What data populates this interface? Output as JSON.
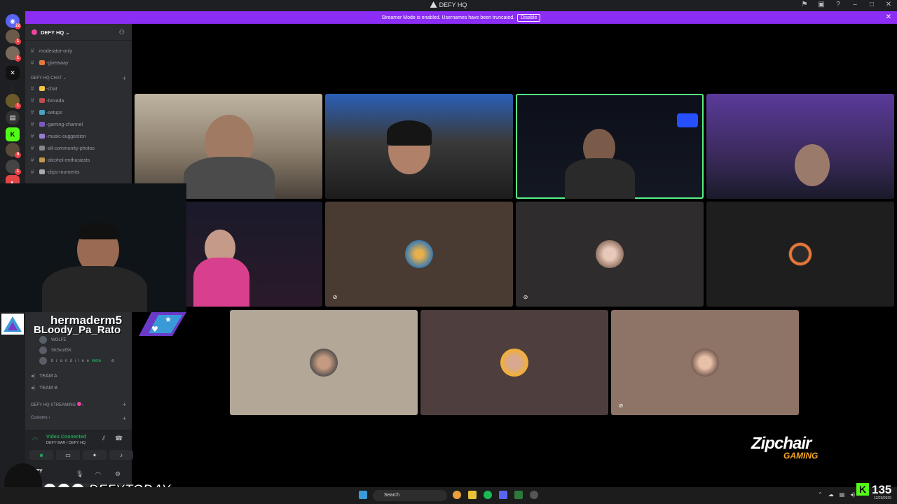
{
  "window": {
    "title": "DEFY HQ"
  },
  "banner": {
    "message": "Streamer Mode is enabled. Usernames have been truncated.",
    "disable_label": "Disable"
  },
  "rail": {
    "badges": [
      "22",
      "1",
      "1",
      "1",
      "9",
      "1"
    ]
  },
  "guild": {
    "name": "DEFY HQ"
  },
  "channels_top": [
    "moderator-only",
    "-giveaway"
  ],
  "category_chat": "DEFY HQ CHAT",
  "channels_chat": [
    "-chat",
    "-bovada",
    "-setups",
    "-gaming-channel",
    "-music-suggestion",
    "-all-community-photos",
    "-alcohol-enthusiasts",
    "-clips-moments"
  ],
  "voice_users": [
    {
      "name": "WOLFE",
      "tag": ""
    },
    {
      "name": "SKSkullSK",
      "tag": ""
    },
    {
      "name": "b r a n d i l e e",
      "tag": "HKIA"
    }
  ],
  "voice_channels": [
    "TEAM A",
    "TEAM B"
  ],
  "category_streaming": "DEFY HQ STREAMING",
  "category_customs": "Customs",
  "voice_panel": {
    "status": "Video Connected",
    "location": "DEFY BAR / DEFY HQ"
  },
  "user": {
    "name": "DEFY"
  },
  "overlay": {
    "name1": "hermaderm5",
    "name2": "BLoody_Pa_Rato",
    "social_handle": "DEFYTODAY"
  },
  "sponsor": {
    "line1": "Zipchair",
    "line2": "GAMING"
  },
  "taskbar": {
    "search_placeholder": "Search",
    "date": "12/20/2025"
  },
  "kick": {
    "count": "135"
  },
  "colors": {
    "accent": "#8c2df5",
    "speaking": "#57f287",
    "connected": "#23a55a",
    "kick": "#53fc18"
  }
}
